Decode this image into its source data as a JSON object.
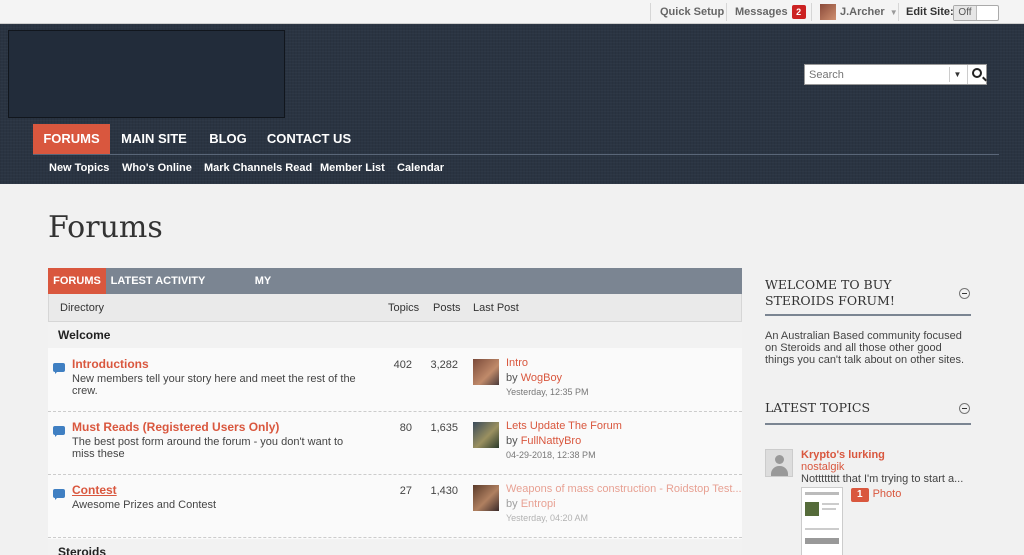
{
  "topbar": {
    "quick_setup": "Quick Setup",
    "messages_label": "Messages",
    "messages_count": "2",
    "user_name": "J.Archer",
    "user_caret": "▼",
    "edit_site_label": "Edit Site:",
    "edit_site_state": "Off"
  },
  "header": {
    "search_placeholder": "Search",
    "search_caret": "▼",
    "nav": [
      "FORUMS",
      "MAIN SITE",
      "BLOG",
      "CONTACT US"
    ],
    "subnav": [
      "New Topics",
      "Who's Online",
      "Mark Channels Read",
      "Member List",
      "Calendar"
    ]
  },
  "page": {
    "title": "Forums"
  },
  "forum": {
    "tabs": [
      "FORUMS",
      "LATEST ACTIVITY",
      "MY SUBSCRIPTIONS"
    ],
    "columns": {
      "directory": "Directory",
      "topics": "Topics",
      "posts": "Posts",
      "last_post": "Last Post"
    },
    "sections": [
      "Welcome",
      "Steroids"
    ],
    "rows": [
      {
        "title": "Introductions",
        "desc": "New members tell your story here and meet the rest of the crew.",
        "topics": "402",
        "posts": "3,282",
        "last_title": "Intro",
        "by_label": "by",
        "last_user": "WogBoy",
        "last_date": "Yesterday, 12:35 PM"
      },
      {
        "title": "Must Reads (Registered Users Only)",
        "desc": "The best post form around the forum - you don't want to miss these",
        "topics": "80",
        "posts": "1,635",
        "last_title": "Lets Update The Forum",
        "by_label": "by",
        "last_user": "FullNattyBro",
        "last_date": "04-29-2018, 12:38 PM"
      },
      {
        "title": "Contest",
        "desc": "Awesome Prizes and Contest",
        "topics": "27",
        "posts": "1,430",
        "last_title": "Weapons of mass construction - Roidstop Test...",
        "by_label": "by",
        "last_user": "Entropi",
        "last_date": "Yesterday, 04:20 AM"
      }
    ]
  },
  "sidebar": {
    "welcome_title": "WELCOME TO BUY STEROIDS FORUM!",
    "welcome_text": "An Australian Based community focused on Steroids and all those other good things you can't talk about on other sites.",
    "latest_title": "LATEST TOPICS",
    "topic": {
      "title": "Krypto's lurking",
      "user": "nostalgik",
      "snippet": "Notttttttt that I'm trying to start a...",
      "photo_count": "1",
      "photo_label": "Photo"
    }
  },
  "colors": {
    "accent": "#d9573e",
    "header_bg": "#2a3442",
    "tabbar": "#7b8592"
  }
}
